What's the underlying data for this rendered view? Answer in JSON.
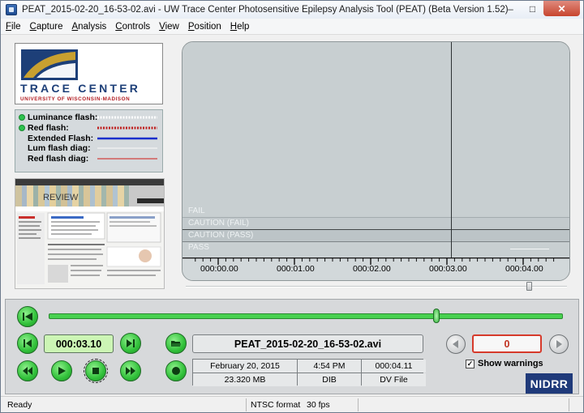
{
  "window": {
    "title": "PEAT_2015-02-20_16-53-02.avi - UW Trace Center Photosensitive Epilepsy Analysis Tool (PEAT) (Beta Version 1.52)",
    "minimize": "–",
    "maximize": "□",
    "close": "✕"
  },
  "menu": [
    {
      "hot": "F",
      "rest": "ile"
    },
    {
      "hot": "C",
      "rest": "apture"
    },
    {
      "hot": "A",
      "rest": "nalysis"
    },
    {
      "hot": "C",
      "rest": "ontrols"
    },
    {
      "hot": "V",
      "rest": "iew"
    },
    {
      "hot": "P",
      "rest": "osition"
    },
    {
      "hot": "H",
      "rest": "elp"
    }
  ],
  "logo": {
    "name": "TRACE CENTER",
    "sub": "UNIVERSITY OF WISCONSIN-MADISON",
    "colors": {
      "blue": "#1d3f78",
      "gold": "#c8a030",
      "red": "#b21e23"
    }
  },
  "legend": [
    {
      "label": "Luminance flash:",
      "dot": true,
      "style": "dotted",
      "color": "#ffffff"
    },
    {
      "label": "Red flash:",
      "dot": true,
      "style": "dotted",
      "color": "#c0201f"
    },
    {
      "label": "Extended Flash:",
      "dot": false,
      "style": "solid",
      "color": "#1a2fcc"
    },
    {
      "label": "Lum flash diag:",
      "dot": false,
      "style": "thin",
      "color": "#f4f4f4"
    },
    {
      "label": "Red flash diag:",
      "dot": false,
      "style": "thin",
      "color": "#d04040"
    }
  ],
  "thumbnail": {
    "caption": "REVIEW"
  },
  "graph": {
    "bands": [
      "FAIL",
      "CAUTION (FAIL)",
      "CAUTION (PASS)",
      "PASS"
    ],
    "ticks": [
      "000:00.00",
      "000:01.00",
      "000:02.00",
      "000:03.00",
      "000:04.00"
    ],
    "cursor_time": 3.1,
    "duration": 4.11
  },
  "controls": {
    "current_time": "000:03.10",
    "filename": "PEAT_2015-02-20_16-53-02.avi",
    "info": {
      "date": "February 20, 2015",
      "time": "4:54 PM",
      "duration": "000:04.11",
      "size": "23.320 MB",
      "codec": "DIB",
      "type": "DV File"
    },
    "warning_count": "0",
    "show_warnings_label": "Show warnings",
    "show_warnings_checked": "✓",
    "position_fraction": 0.754,
    "nidrr": "NIDRR"
  },
  "status": {
    "ready": "Ready",
    "format": "NTSC format",
    "fps": "30 fps"
  },
  "colors": {
    "accent_green": "#3fcf47",
    "warning_red": "#d63a2b",
    "graph_bg": "#c8cfd1"
  }
}
